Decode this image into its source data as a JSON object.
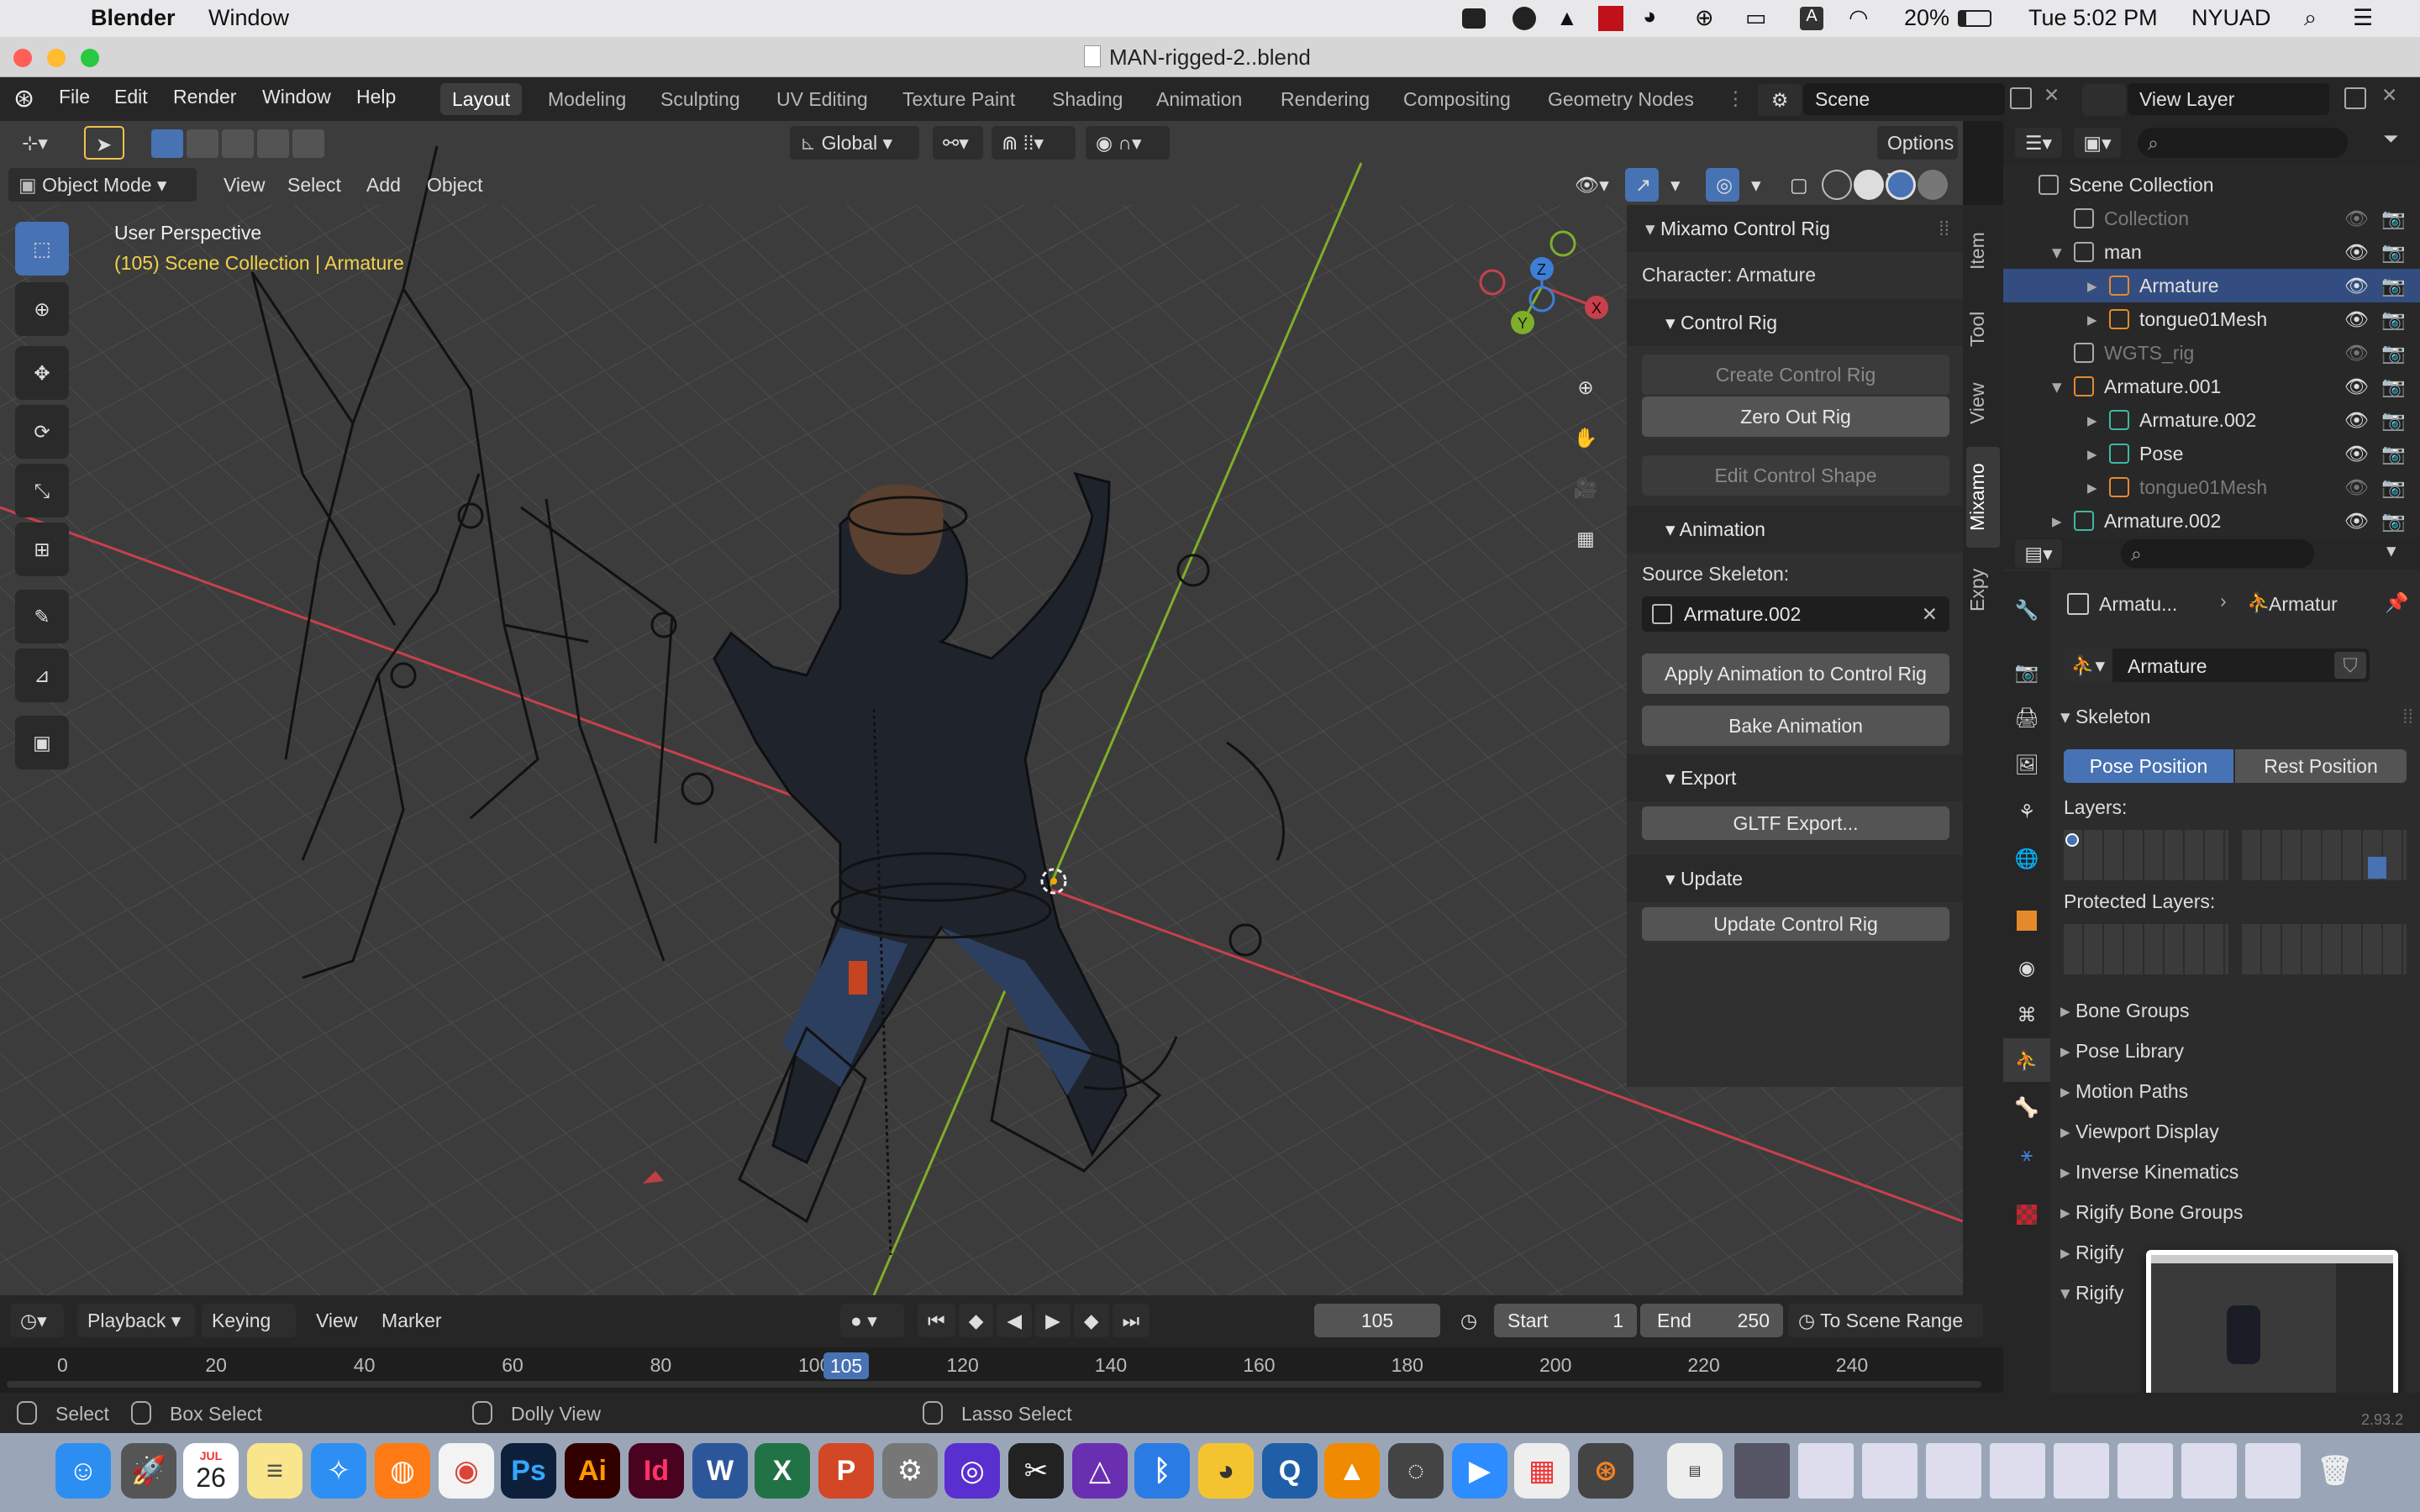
{
  "macbar": {
    "app": "Blender",
    "menu": [
      "Window"
    ],
    "battery": "20%",
    "clock": "Tue 5:02 PM",
    "user": "NYUAD"
  },
  "window": {
    "title": "MAN-rigged-2..blend"
  },
  "topbar": {
    "menus": [
      "File",
      "Edit",
      "Render",
      "Window",
      "Help"
    ],
    "workspaces": [
      "Layout",
      "Modeling",
      "Sculpting",
      "UV Editing",
      "Texture Paint",
      "Shading",
      "Animation",
      "Rendering",
      "Compositing",
      "Geometry Nodes"
    ],
    "active_workspace": "Layout",
    "scene": "Scene",
    "view_layer": "View Layer"
  },
  "viewport": {
    "mode": "Object Mode",
    "menus": [
      "View",
      "Select",
      "Add",
      "Object"
    ],
    "orientation": "Global",
    "options": "Options",
    "perspective_label": "User Perspective",
    "context_label": "(105) Scene Collection | Armature",
    "gizmo": {
      "x": "X",
      "y": "Y",
      "z": "Z"
    }
  },
  "npanel": {
    "title": "Mixamo Control Rig",
    "character": "Character: Armature",
    "control_rig_section": "Control Rig",
    "create_control_rig": "Create Control Rig",
    "zero_out_rig": "Zero Out Rig",
    "edit_control_shape": "Edit Control Shape",
    "animation_section": "Animation",
    "source_skeleton_label": "Source Skeleton:",
    "source_skeleton_value": "Armature.002",
    "apply_animation": "Apply Animation to Control Rig",
    "bake_animation": "Bake Animation",
    "export_section": "Export",
    "gltf_export": "GLTF Export...",
    "update_section": "Update",
    "update_control_rig": "Update Control Rig",
    "tabs": [
      "Item",
      "Tool",
      "View",
      "Mixamo",
      "Expy"
    ]
  },
  "outliner": {
    "rows": [
      {
        "name": "Scene Collection",
        "indent": 0
      },
      {
        "name": "Collection",
        "indent": 1,
        "dim": true
      },
      {
        "name": "man",
        "indent": 1
      },
      {
        "name": "Armature",
        "indent": 2
      },
      {
        "name": "tongue01Mesh",
        "indent": 2
      },
      {
        "name": "WGTS_rig",
        "indent": 1,
        "dim": true
      },
      {
        "name": "Armature.001",
        "indent": 1
      },
      {
        "name": "Armature.002",
        "indent": 2
      },
      {
        "name": "Pose",
        "indent": 2
      },
      {
        "name": "tongue01Mesh",
        "indent": 2,
        "dim": true
      },
      {
        "name": "Armature.002",
        "indent": 1
      }
    ]
  },
  "properties": {
    "breadcrumb_object": "Armatu...",
    "breadcrumb_data": "Armatur",
    "datablock": "Armature",
    "skeleton": "Skeleton",
    "pose_position": "Pose Position",
    "rest_position": "Rest Position",
    "layers": "Layers:",
    "protected_layers": "Protected Layers:",
    "sections": [
      "Bone Groups",
      "Pose Library",
      "Motion Paths",
      "Viewport Display",
      "Inverse Kinematics",
      "Rigify Bone Groups",
      "Rigify",
      "Rigify"
    ]
  },
  "timeline": {
    "menus": [
      "Playback",
      "Keying",
      "View",
      "Marker"
    ],
    "current_frame": "105",
    "start_label": "Start",
    "start": "1",
    "end_label": "End",
    "end": "250",
    "scene_range": "To Scene Range",
    "ruler": [
      "0",
      "20",
      "40",
      "60",
      "80",
      "100",
      "120",
      "140",
      "160",
      "180",
      "200",
      "220",
      "240"
    ]
  },
  "status": {
    "select": "Select",
    "box_select": "Box Select",
    "dolly": "Dolly View",
    "lasso": "Lasso Select",
    "version": "2.93.2"
  },
  "dock": {
    "calendar_month": "JUL",
    "calendar_day": "26"
  }
}
